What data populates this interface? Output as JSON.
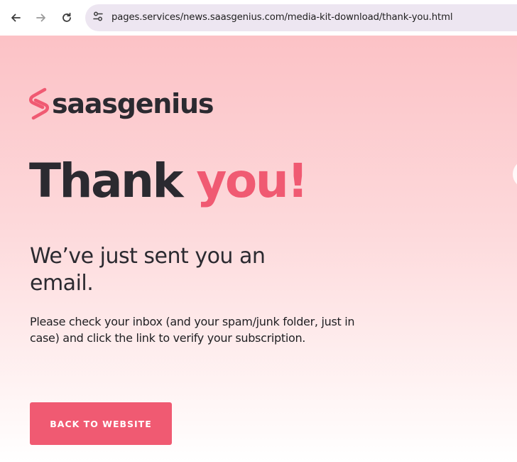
{
  "browser": {
    "url": "pages.services/news.saasgenius.com/media-kit-download/thank-you.html",
    "back_icon": "arrow-left-icon",
    "forward_icon": "arrow-right-icon",
    "reload_icon": "reload-icon",
    "site_info_icon": "tune-icon"
  },
  "page": {
    "logo_text": "saasgenius",
    "headline_dark": "Thank ",
    "headline_accent": "you!",
    "subhead": "We’ve just sent you an email.",
    "body": "Please check your inbox (and your spam/junk folder, just in case) and click the link to verify your subscription.",
    "cta_label": "BACK TO WEBSITE"
  },
  "colors": {
    "accent": "#f05a72",
    "text_dark": "#2b2a30",
    "background_top": "#fcc2c6",
    "background_bottom": "#ffffff",
    "omnibox": "#ede6f1"
  }
}
